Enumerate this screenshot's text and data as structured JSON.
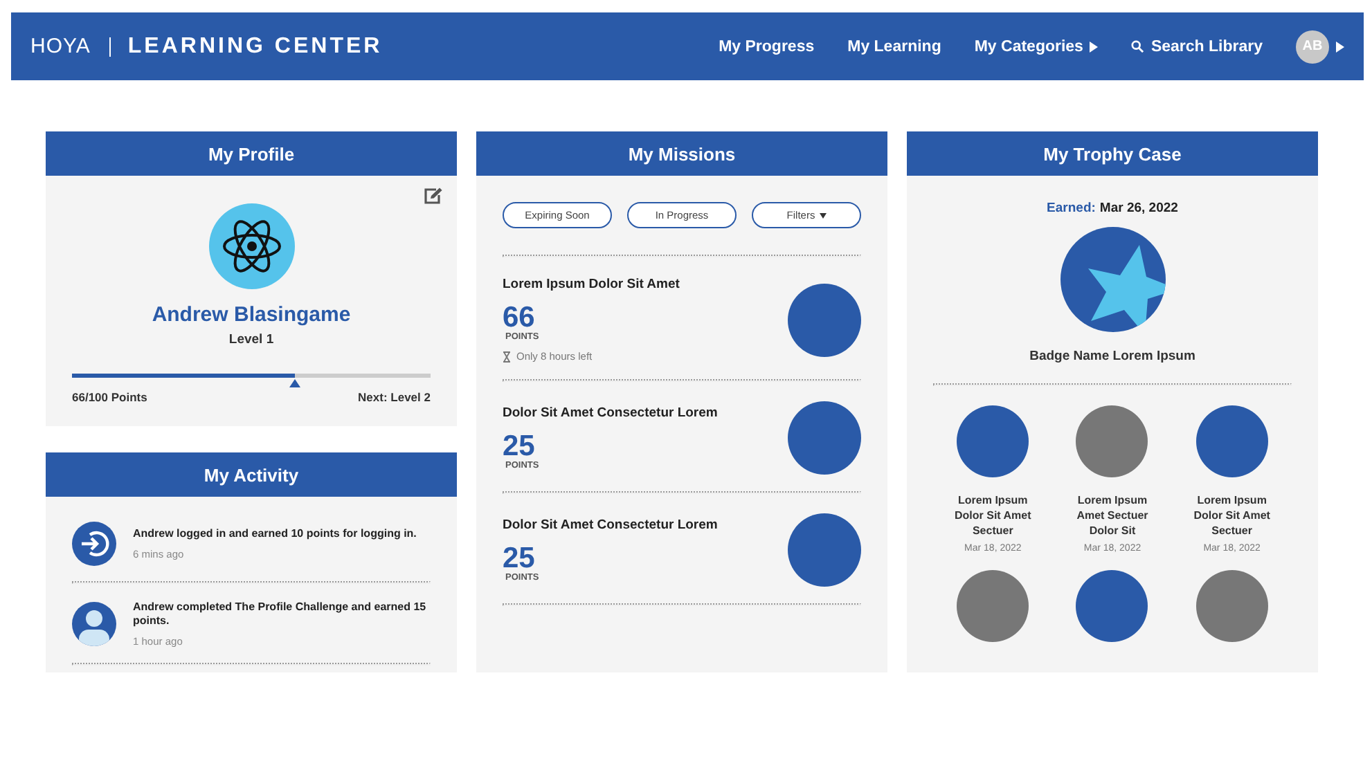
{
  "header": {
    "logo": "HOYA",
    "title": "LEARNING CENTER",
    "nav": [
      {
        "label": "My Progress",
        "kind": "link"
      },
      {
        "label": "My Learning",
        "kind": "link"
      },
      {
        "label": "My Categories",
        "kind": "menu"
      },
      {
        "label": "Search Library",
        "kind": "search"
      }
    ],
    "avatar": "AB"
  },
  "profile": {
    "title": "My Profile",
    "name": "Andrew Blasingame",
    "level_label": "Level 1",
    "progress": {
      "level": 0.62
    },
    "points": "66/100 Points",
    "next": "Next: Level 2"
  },
  "activity": {
    "title": "My Activity",
    "items": [
      {
        "kind": "login",
        "text": "Andrew logged in and earned 10 points for logging in.",
        "time": "6 mins ago"
      },
      {
        "kind": "user",
        "text": "Andrew completed The Profile Challenge and earned 15 points.",
        "time": "1 hour ago"
      }
    ]
  },
  "missions": {
    "title": "My Missions",
    "filters": [
      {
        "label": "Expiring Soon",
        "kind": "chip"
      },
      {
        "label": "In Progress",
        "kind": "chip"
      },
      {
        "label": "Filters",
        "kind": "dropdown"
      }
    ],
    "items": [
      {
        "title": "Lorem Ipsum Dolor Sit Amet",
        "points": "66",
        "unit": "POINTS",
        "note": "Only 8 hours left"
      },
      {
        "title": "Dolor Sit Amet Consectetur Lorem",
        "points": "25",
        "unit": "POINTS"
      },
      {
        "title": "Dolor Sit Amet Consectetur Lorem",
        "points": "25",
        "unit": "POINTS"
      }
    ]
  },
  "trophies": {
    "title": "My Trophy Case",
    "earned_label": "Earned:",
    "earned_date": "Mar 26, 2022",
    "featured_name": "Badge Name Lorem Ipsum",
    "badges": [
      {
        "earned": true,
        "name": "Lorem Ipsum Dolor Sit Amet Sectuer",
        "date": "Mar 18, 2022"
      },
      {
        "earned": false,
        "name": "Lorem Ipsum Amet Sectuer Dolor Sit",
        "date": "Mar 18, 2022"
      },
      {
        "earned": true,
        "name": "Lorem Ipsum Dolor Sit Amet Sectuer",
        "date": "Mar 18, 2022"
      },
      {
        "earned": false
      },
      {
        "earned": true
      },
      {
        "earned": false
      }
    ]
  }
}
